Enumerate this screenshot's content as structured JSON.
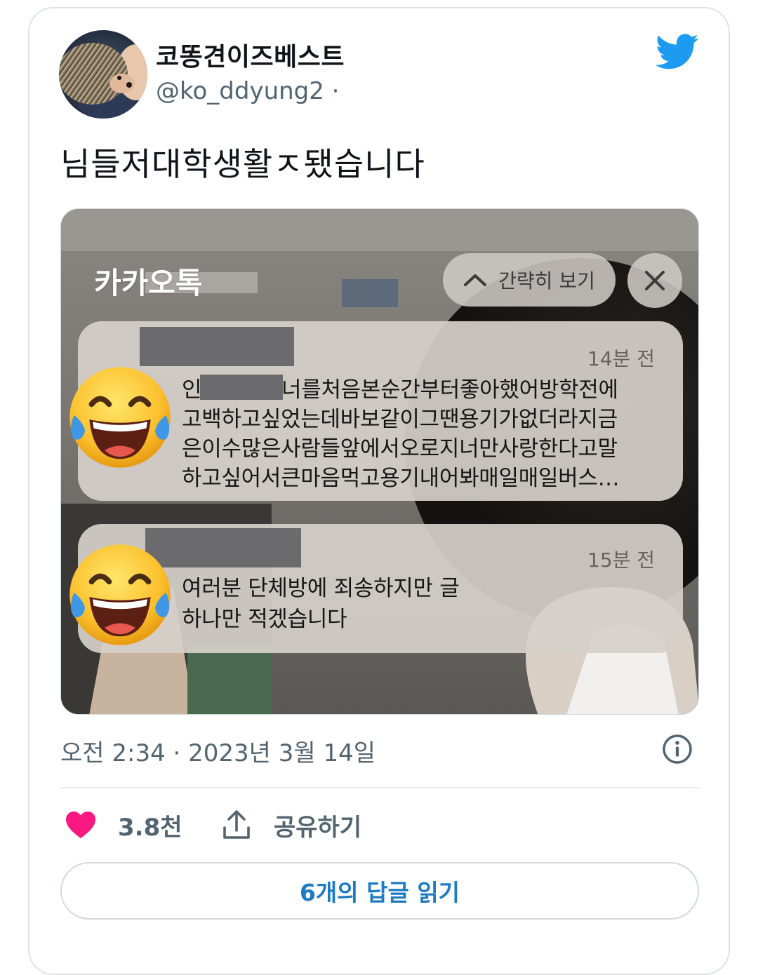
{
  "tweet": {
    "display_name": "코똥견이즈베스트",
    "handle": "@ko_ddyung2 ·",
    "text": "님들저대학생활ㅈ됐습니다",
    "timestamp": "오전 2:34 · 2023년 3월 14일",
    "likes": "3.8천",
    "share_label": "공유하기",
    "replies_label": "6개의 답글 읽기",
    "avatar_icon": "hedgehog-photo",
    "brand_icon": "twitter-bird-icon"
  },
  "screenshot": {
    "app_title": "카카오톡",
    "collapse_label": "간략히 보기",
    "notifications": [
      {
        "time": "14분 전",
        "lines": [
          "인",
          "너를처음본순간부터좋아했어방학전에",
          "고백하고싶었는데바보같이그땐용기가없더라지금",
          "은이수많은사람들앞에서오로지너만사랑한다고말",
          "하고싶어서큰마음먹고용기내어봐매일매일버스…"
        ]
      },
      {
        "time": "15분 전",
        "lines": [
          "여러분 단체방에 죄송하지만 글",
          "하나만 적겠습니다"
        ]
      }
    ]
  },
  "colors": {
    "accent": "#1d9bf0",
    "heart": "#f91880",
    "muted": "#536471",
    "link": "#1d7bc3"
  }
}
